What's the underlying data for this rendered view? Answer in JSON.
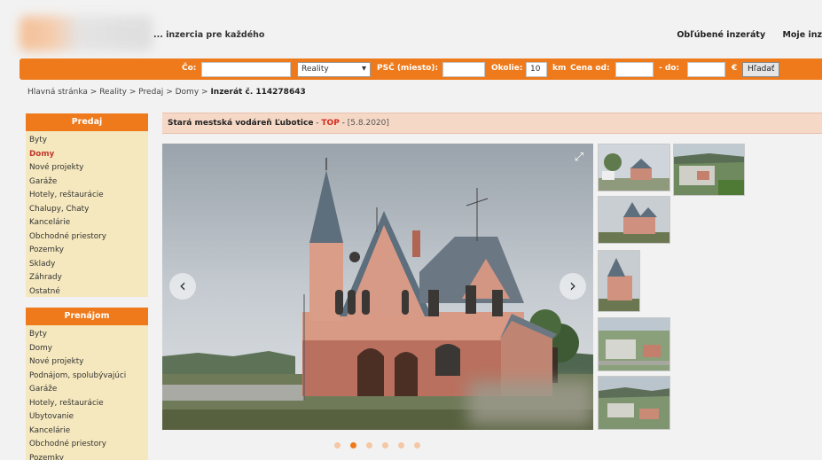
{
  "header": {
    "tagline": "... inzercia pre každého",
    "links": [
      "Obľúbené inzeráty",
      "Moje inz"
    ]
  },
  "search": {
    "co_label": "Čo:",
    "co_value": "",
    "category_selected": "Reality",
    "psc_label": "PSČ (miesto):",
    "psc_value": "",
    "okolie_label": "Okolie:",
    "okolie_value": "10",
    "km_label": "km",
    "cena_od_label": "Cena od:",
    "cena_od_value": "",
    "do_label": "- do:",
    "do_value": "",
    "currency": "€",
    "button": "Hľadať"
  },
  "breadcrumb": {
    "items": [
      "Hlavná stránka",
      "Reality",
      "Predaj",
      "Domy"
    ],
    "separator": ">",
    "current": "Inzerát č. 114278643"
  },
  "sidebar": {
    "predaj": {
      "heading": "Predaj",
      "items": [
        "Byty",
        "Domy",
        "Nové projekty",
        "Garáže",
        "Hotely, reštaurácie",
        "Chalupy, Chaty",
        "Kancelárie",
        "Obchodné priestory",
        "Pozemky",
        "Sklady",
        "Záhrady",
        "Ostatné"
      ],
      "active": "Domy"
    },
    "prenajom": {
      "heading": "Prenájom",
      "items": [
        "Byty",
        "Domy",
        "Nové projekty",
        "Podnájom, spolubývajúci",
        "Garáže",
        "Hotely, reštaurácie",
        "Ubytovanie",
        "Kancelárie",
        "Obchodné priestory",
        "Pozemky"
      ]
    }
  },
  "listing": {
    "title": "Stará mestská vodáreň Ľubotice",
    "sep1": " - ",
    "badge": "TOP",
    "sep2": " - ",
    "date": "[5.8.2020]"
  },
  "gallery": {
    "prev_icon": "chevron-left-icon",
    "next_icon": "chevron-right-icon",
    "expand_icon": "expand-icon",
    "dot_count": 6,
    "active_dot": 1
  },
  "colors": {
    "accent": "#ee7a1c",
    "sidebar_bg": "#f5e8be",
    "title_bg": "#f6d8c6",
    "top_badge": "#d32a1c"
  }
}
